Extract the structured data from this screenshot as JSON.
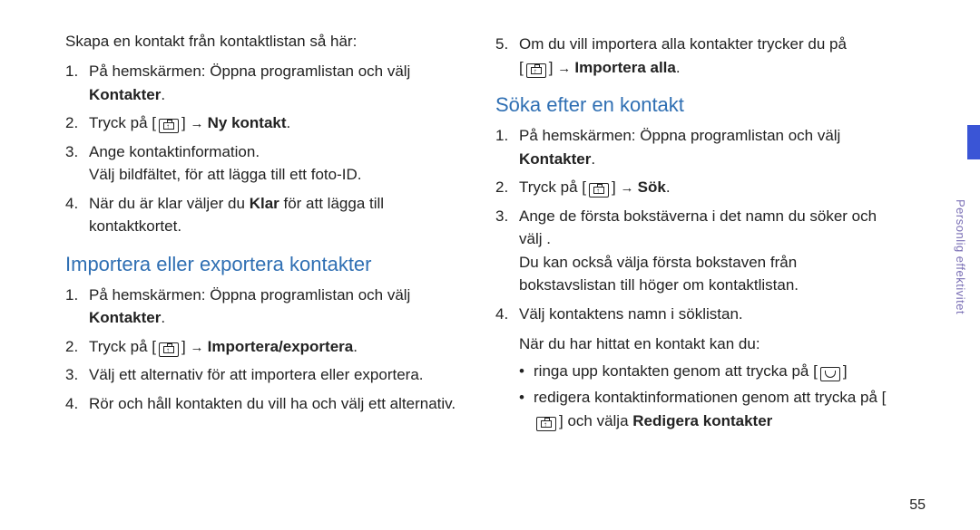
{
  "pageNumber": "55",
  "sideLabel": "Personlig effektivitet",
  "left": {
    "intro": "Skapa en kontakt från kontaktlistan så här:",
    "steps1": [
      {
        "n": "1.",
        "pre": "På hemskärmen: Öppna programlistan och välj ",
        "bold": "Kontakter",
        "post": "."
      },
      {
        "n": "2.",
        "pre": "Tryck på [",
        "icon": "menu",
        "mid": "] ",
        "arrow": "→ ",
        "bold": "Ny kontakt",
        "post": "."
      },
      {
        "n": "3.",
        "line1": "Ange kontaktinformation.",
        "line2": "Välj bildfältet, för att lägga till ett foto-ID."
      },
      {
        "n": "4.",
        "pre": "När du är klar väljer du ",
        "bold": "Klar",
        "post": " för att lägga till kontaktkortet."
      }
    ],
    "heading2": "Importera eller exportera kontakter",
    "steps2": [
      {
        "n": "1.",
        "pre": "På hemskärmen: Öppna programlistan och välj ",
        "bold": "Kontakter",
        "post": "."
      },
      {
        "n": "2.",
        "pre": "Tryck på [",
        "icon": "menu",
        "mid": "] ",
        "arrow": "→ ",
        "bold": "Importera/exportera",
        "post": "."
      },
      {
        "n": "3.",
        "text": "Välj ett alternativ för att importera eller exportera."
      },
      {
        "n": "4.",
        "text": "Rör och håll kontakten du vill ha och välj ett alternativ."
      }
    ]
  },
  "right": {
    "steps1": [
      {
        "n": "5.",
        "line1pre": "Om du vill importera alla kontakter trycker du på ",
        "line2pre": "[",
        "icon": "menu",
        "line2mid": "] ",
        "arrow": "→ ",
        "bold": "Importera alla",
        "post": "."
      }
    ],
    "heading": "Söka efter en kontakt",
    "steps2": [
      {
        "n": "1.",
        "pre": "På hemskärmen: Öppna programlistan och välj ",
        "bold": "Kontakter",
        "post": "."
      },
      {
        "n": "2.",
        "pre": "Tryck på [",
        "icon": "menu",
        "mid": "] ",
        "arrow": "→ ",
        "bold": "Sök",
        "post": "."
      },
      {
        "n": "3.",
        "line1": "Ange de första bokstäverna i det namn du söker och välj ",
        "line2": "Du kan också välja första bokstaven från bokstavslistan till höger om kontaktlistan.",
        "postSymbol": "."
      },
      {
        "n": "4.",
        "text": "Välj kontaktens namn i söklistan."
      }
    ],
    "followup": "När du har hittat en kontakt kan du:",
    "bullets": [
      {
        "pre": "ringa upp kontakten genom att trycka på [",
        "icon": "call",
        "post": "]"
      },
      {
        "pre": "redigera kontaktinformationen genom att trycka på [",
        "icon": "menu",
        "mid": "] och välja ",
        "bold": "Redigera kontakter"
      }
    ]
  }
}
